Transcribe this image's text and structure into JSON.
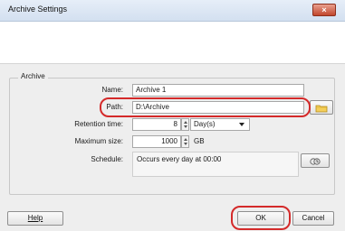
{
  "window": {
    "title": "Archive Settings",
    "close_glyph": "×"
  },
  "group": {
    "title": "Archive"
  },
  "name": {
    "label": "Name:",
    "value": "Archive 1"
  },
  "path": {
    "label": "Path:",
    "value": "D:\\Archive",
    "browse_icon": "folder-icon"
  },
  "retention": {
    "label": "Retention time:",
    "value": "8",
    "unit": "Day(s)"
  },
  "max_size": {
    "label": "Maximum size:",
    "value": "1000",
    "unit": "GB"
  },
  "schedule": {
    "label": "Schedule:",
    "value": "Occurs every day at 00:00",
    "edit_icon": "schedule-icon"
  },
  "buttons": {
    "help": "Help",
    "ok": "OK",
    "cancel": "Cancel"
  },
  "colors": {
    "highlight": "#d42a2a",
    "close": "#c1462d"
  }
}
